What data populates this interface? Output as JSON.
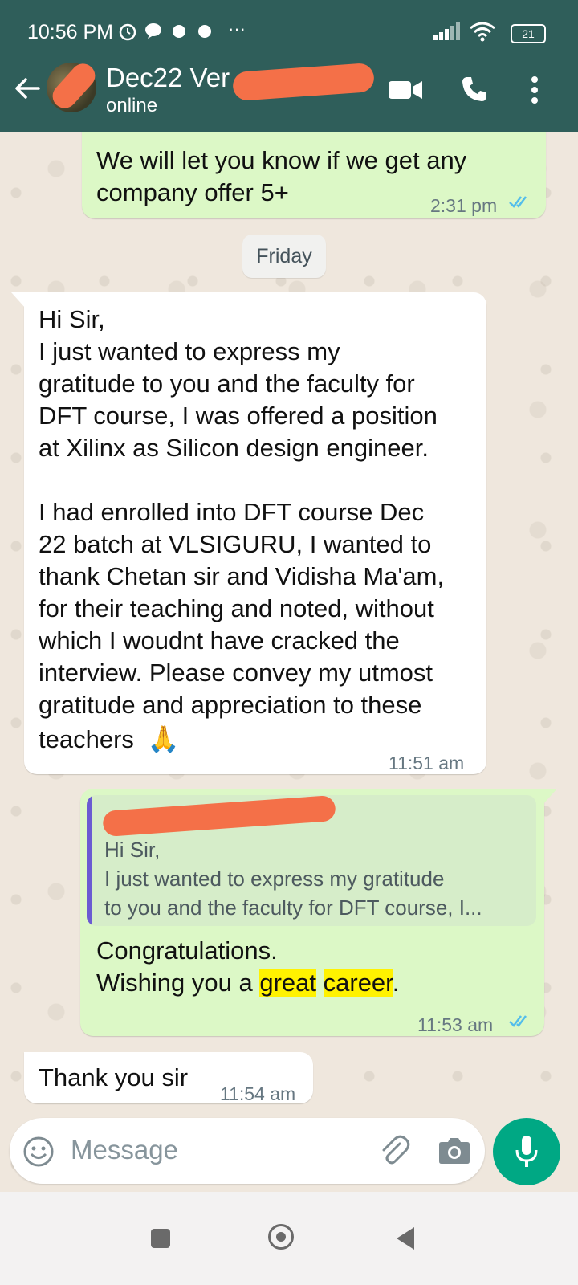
{
  "status_bar": {
    "time": "10:56 PM",
    "more": "···",
    "battery": "21"
  },
  "header": {
    "title": "Dec22 Ver",
    "status": "online"
  },
  "messages": {
    "m1": {
      "text": "We will let you know if we get any\ncompany offer 5+",
      "time": "2:31 pm"
    },
    "day": "Friday",
    "m2": {
      "text": "Hi Sir,\nI just wanted to express my\ngratitude to you and the faculty for\nDFT course, I was offered a position\nat Xilinx as Silicon design engineer.\n\nI had enrolled into DFT course Dec\n22 batch at VLSIGURU, I wanted to\nthank Chetan sir and Vidisha Ma'am,\nfor their teaching and noted, without\nwhich I woudnt have cracked the\ninterview. Please convey my utmost\ngratitude and appreciation to these",
      "last_line": "teachers",
      "emoji": "🙏",
      "time": "11:51 am"
    },
    "m3": {
      "quote": "Hi Sir,\nI just wanted to express my gratitude\nto you and the faculty for DFT course, I...",
      "line1": "Congratulations.",
      "line2_prefix": "Wishing you a ",
      "hl1": "great",
      "hl2": "career",
      "line2_suffix": ".",
      "time": "11:53 am"
    },
    "m4": {
      "text": "Thank you sir",
      "time": "11:54 am"
    }
  },
  "composer": {
    "placeholder": "Message"
  },
  "colors": {
    "header": "#2f5e5a",
    "outgoing": "#dcf8c6",
    "incoming": "#ffffff",
    "tick": "#53bdeb",
    "mic": "#00a884",
    "highlight": "#fff200"
  }
}
